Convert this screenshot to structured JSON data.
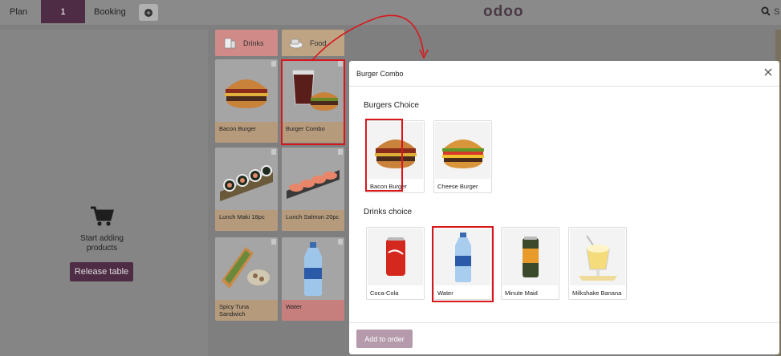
{
  "navbar": {
    "plan_label": "Plan",
    "order_number": "1",
    "booking_label": "Booking",
    "add_order_icon": "plus-circle-icon",
    "logo_text": "odoo",
    "search_label": "S"
  },
  "order_panel": {
    "empty_icon": "cart-icon",
    "empty_message": "Start adding products",
    "release_button": "Release table"
  },
  "categories": [
    {
      "label": "Drinks",
      "icon": "drinks-icon",
      "color": "#d08a88"
    },
    {
      "label": "Food",
      "icon": "food-icon",
      "color": "#bfa484"
    }
  ],
  "products": [
    {
      "name": "Bacon Burger",
      "category": "food"
    },
    {
      "name": "Burger Combo",
      "category": "food",
      "highlighted": true
    },
    {
      "name": "Lunch Maki 18pc",
      "category": "food"
    },
    {
      "name": "Lunch Salmon 20pc",
      "category": "food"
    },
    {
      "name": "Spicy Tuna Sandwich",
      "category": "food"
    },
    {
      "name": "Water",
      "category": "drink"
    }
  ],
  "modal": {
    "title": "Burger Combo",
    "sections": [
      {
        "title": "Burgers Choice",
        "choices": [
          {
            "name": "Bacon Burger",
            "selected": true
          },
          {
            "name": "Cheese Burger",
            "selected": false
          }
        ]
      },
      {
        "title": "Drinks choice",
        "choices": [
          {
            "name": "Coca-Cola",
            "selected": false
          },
          {
            "name": "Water",
            "selected": true
          },
          {
            "name": "Minute Maid",
            "selected": false
          },
          {
            "name": "Milkshake Banana",
            "selected": false
          }
        ]
      }
    ],
    "add_button": "Add to order"
  },
  "colors": {
    "brand": "#4f2c45",
    "highlight": "#d8171c",
    "overlay": "#7f7f7f"
  }
}
